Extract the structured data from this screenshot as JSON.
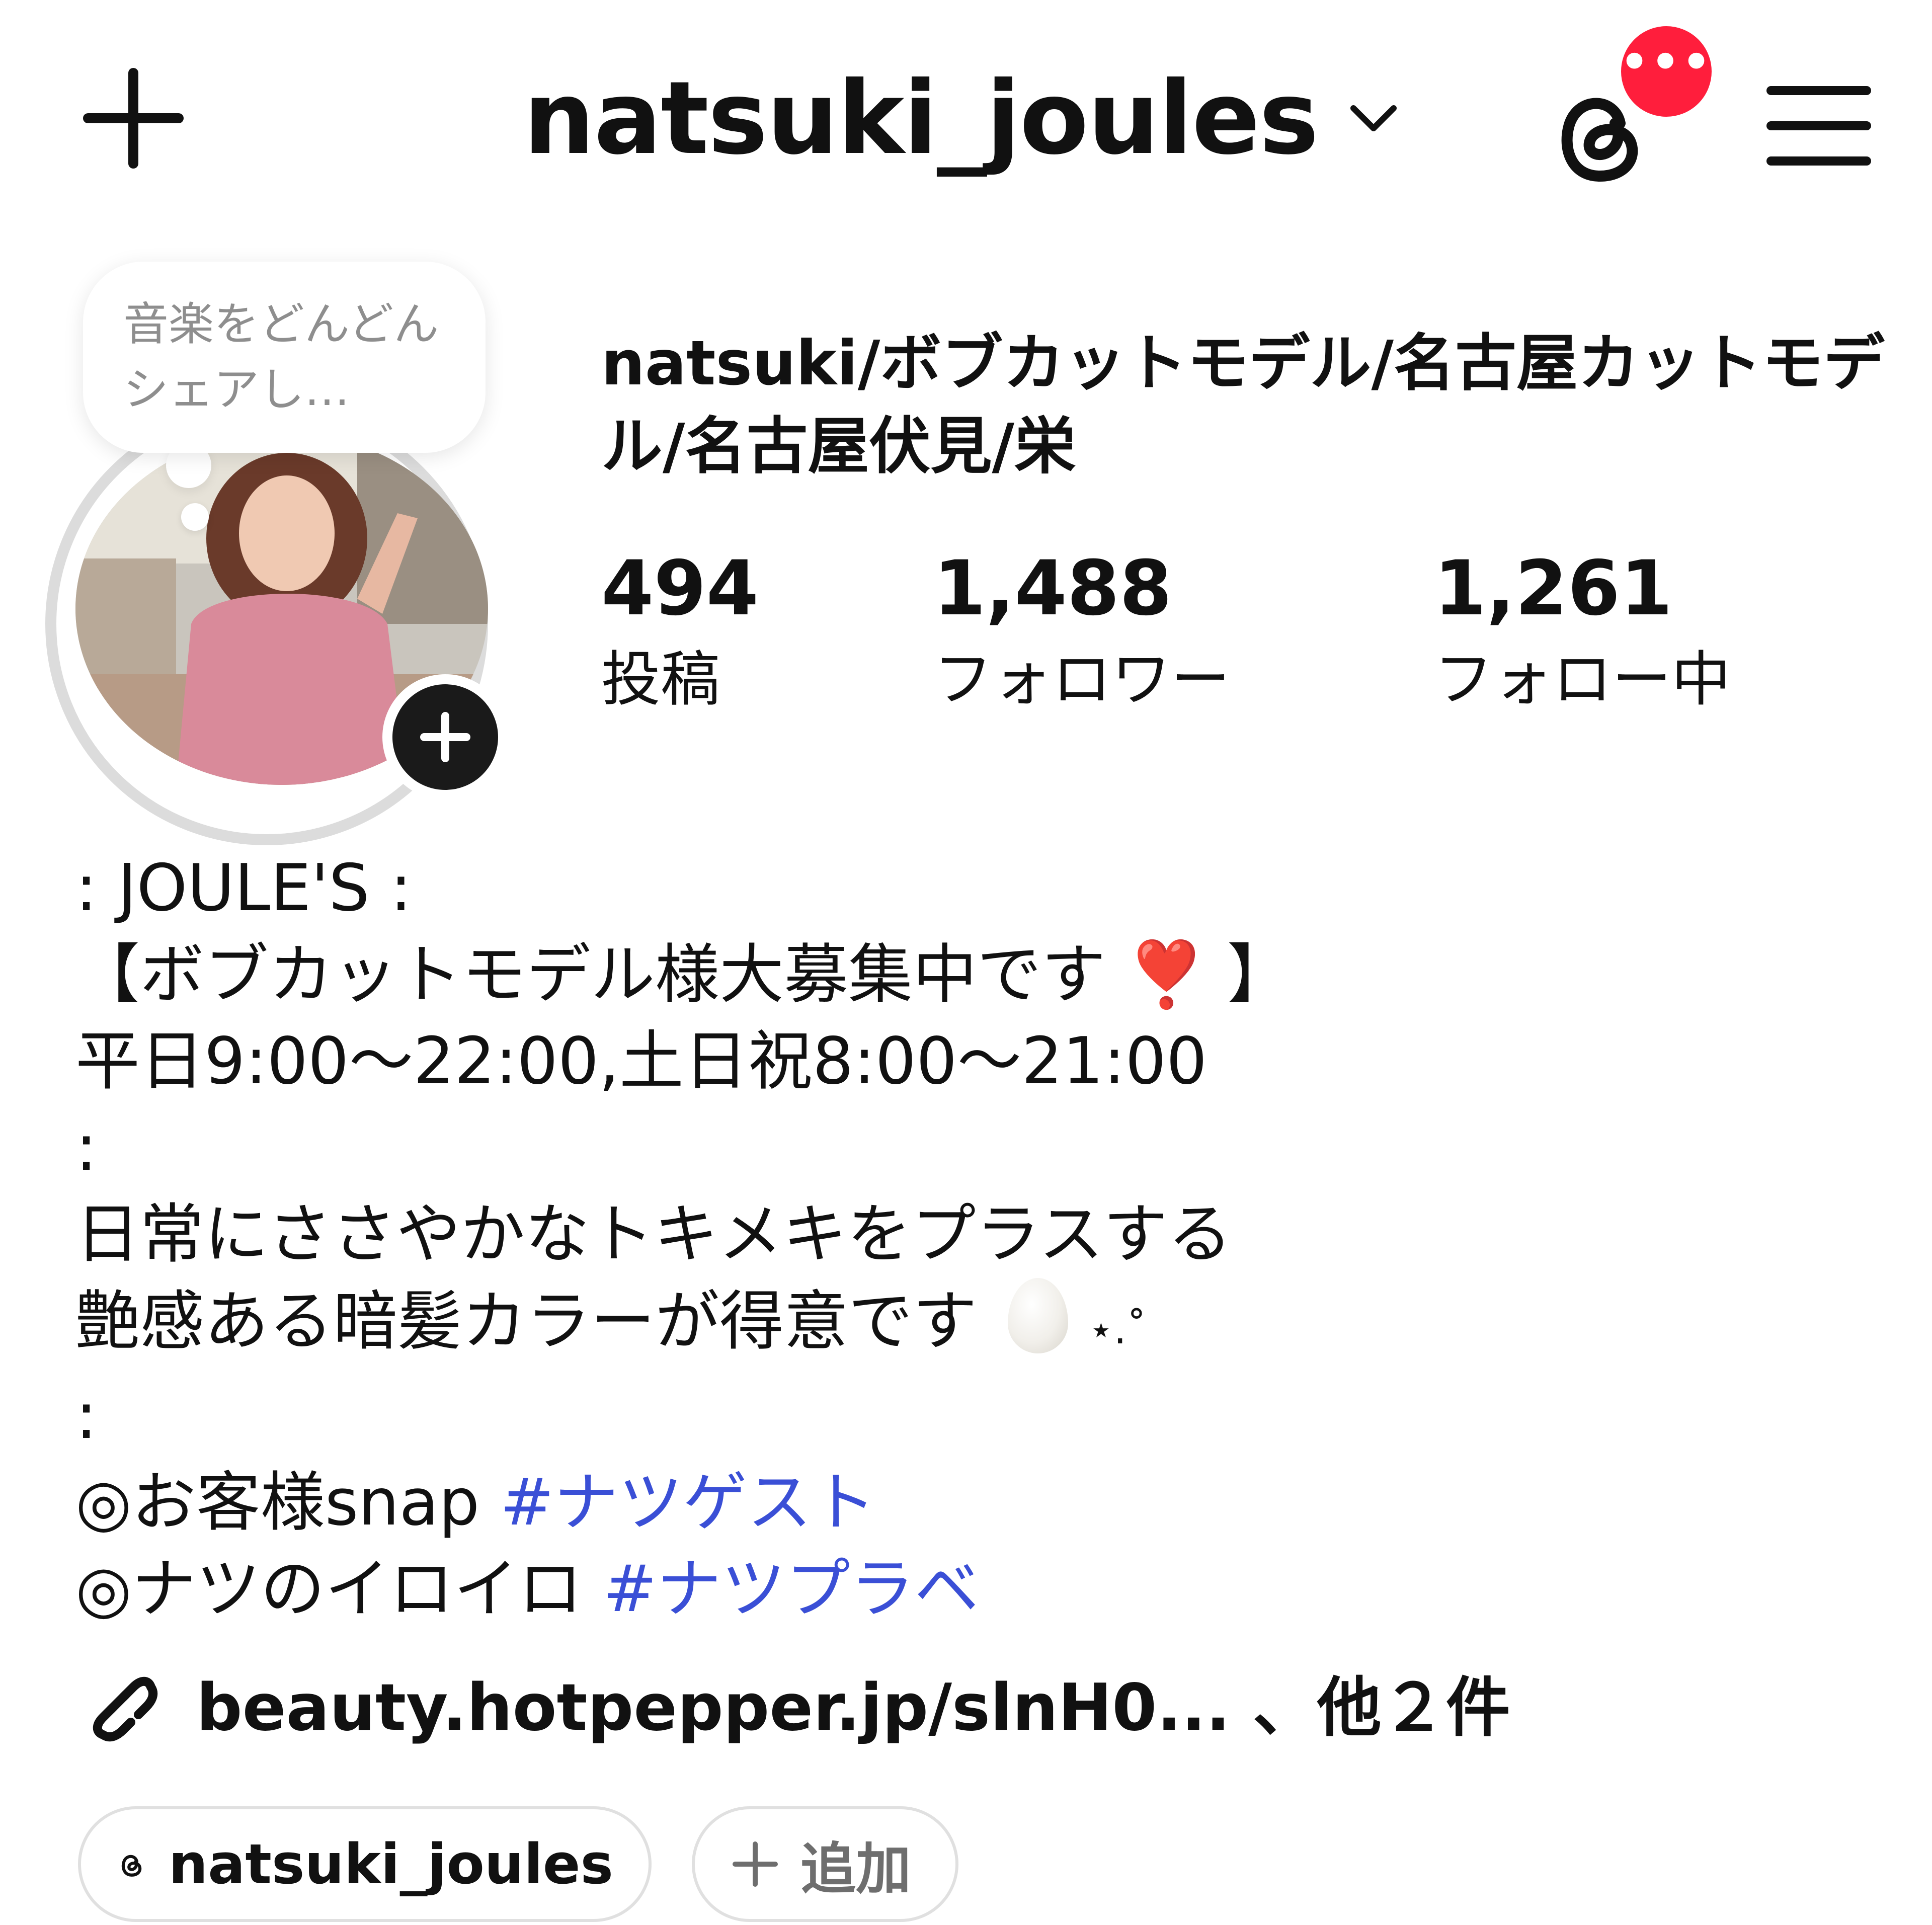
{
  "header": {
    "username": "natsuki_joules",
    "notification_badge": "•••",
    "accent_badge_color": "#ff1e3c"
  },
  "note": {
    "text": "音楽をどんどんシェアし…"
  },
  "profile": {
    "display_name": "natsuki/ボブカットモデル/名古屋カットモデル/名古屋伏見/栄",
    "stats": [
      {
        "value": "494",
        "label": "投稿"
      },
      {
        "value": "1,488",
        "label": "フォロワー"
      },
      {
        "value": "1,261",
        "label": "フォロー中"
      }
    ]
  },
  "bio": {
    "line1": ": JOULE'S :",
    "line2_open": "【ボブカットモデル様大募集中です",
    "line2_heart": "❣️",
    "line2_close": "】",
    "line3": "平日9:00～22:00,土日祝8:00～21:00",
    "line4": ":",
    "line5": "日常にささやかなトキメキをプラスする",
    "line6": "艶感ある暗髪カラーが得意です",
    "line6_sparkle": "⋆.˚",
    "line7": ":",
    "line8_text": "◎お客様snap ",
    "line8_tag": "#ナツゲスト",
    "line9_text": "◎ナツのイロイロ ",
    "line9_tag": "#ナツプラベ",
    "hashtag_color": "#3a4fd6"
  },
  "link": {
    "text": "beauty.hotpepper.jp/slnH0... 、他２件"
  },
  "chips": {
    "threads_handle": "natsuki_joules",
    "add_label": "追加"
  }
}
